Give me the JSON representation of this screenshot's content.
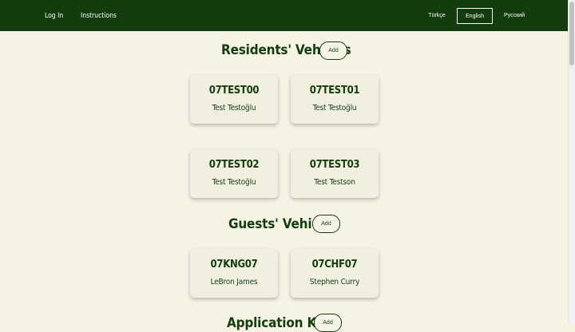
{
  "nav": {
    "login": "Log In",
    "instructions": "Instructions",
    "languages": [
      "Türkçe",
      "English",
      "Русский"
    ],
    "active_language": "English"
  },
  "residents": {
    "title": "Residents' Vehicles",
    "add_label": "Add",
    "vehicles": [
      {
        "plate": "07TEST00",
        "owner": "Test Testoğlu"
      },
      {
        "plate": "07TEST01",
        "owner": "Test Testoğlu"
      },
      {
        "plate": "07TEST02",
        "owner": "Test Testoğlu"
      },
      {
        "plate": "07TEST03",
        "owner": "Test Testson"
      }
    ]
  },
  "guests": {
    "title": "Guests' Vehicles",
    "add_label": "Add",
    "vehicles": [
      {
        "plate": "07KNG07",
        "owner": "LeBron James"
      },
      {
        "plate": "07CHF07",
        "owner": "Stephen Curry"
      }
    ]
  },
  "keys": {
    "title": "Application Keys",
    "add_label": "Add"
  },
  "colors": {
    "navbar": "#133d0e",
    "background": "#f5f3e4",
    "card": "#f1efdf",
    "text": "#133d0e"
  }
}
